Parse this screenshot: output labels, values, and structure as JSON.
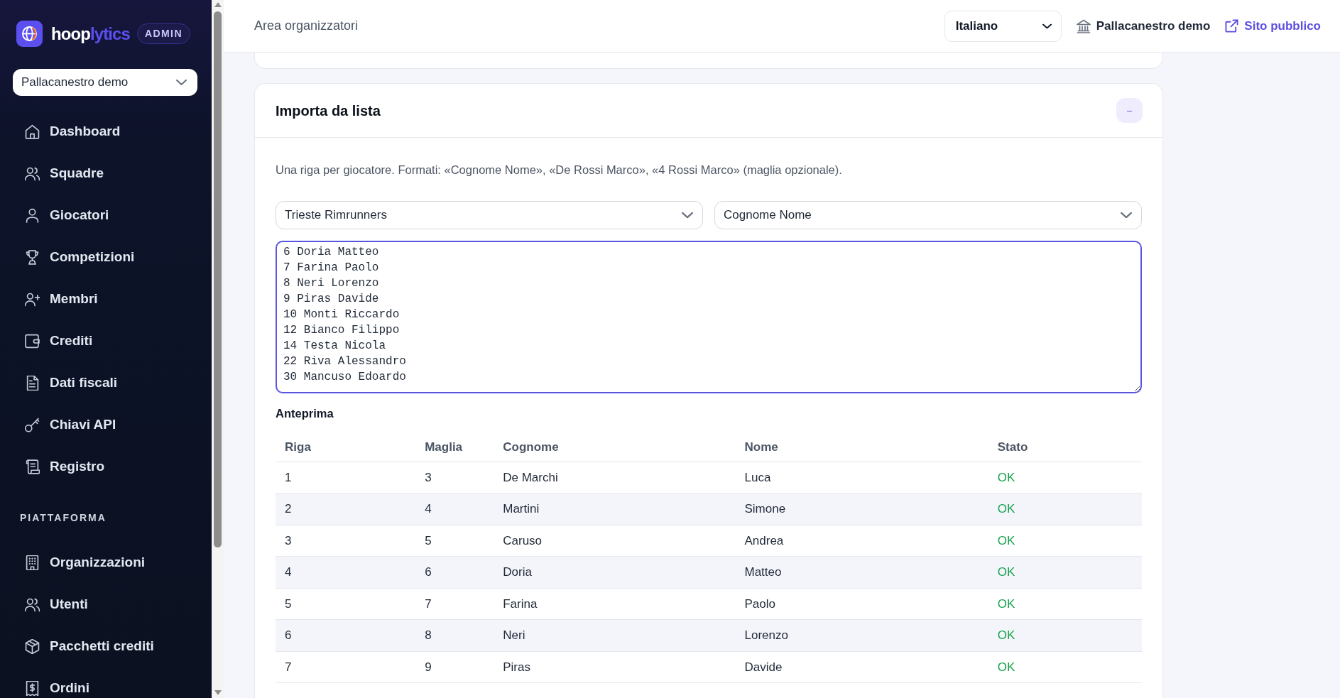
{
  "sidebar": {
    "logo": {
      "parts": [
        {
          "text": "hoop",
          "accent": false
        },
        {
          "text": "lytics",
          "accent": true
        }
      ]
    },
    "badge": "ADMIN",
    "organization_select": {
      "value": "Pallacanestro demo"
    },
    "sections": [
      {
        "items": [
          {
            "label": "Dashboard",
            "selected": false
          },
          {
            "label": "Squadre",
            "selected": false
          },
          {
            "label": "Giocatori",
            "selected": false
          },
          {
            "label": "Competizioni",
            "selected": false
          },
          {
            "label": "Membri",
            "selected": false
          },
          {
            "label": "Crediti",
            "selected": false
          },
          {
            "label": "Dati fiscali",
            "selected": false
          },
          {
            "label": "Chiavi API",
            "selected": false
          },
          {
            "label": "Registro",
            "selected": false
          }
        ]
      },
      {
        "heading": "PIATTAFORMA",
        "items": [
          {
            "label": "Organizzazioni",
            "selected": false
          },
          {
            "label": "Utenti",
            "selected": false
          },
          {
            "label": "Pacchetti crediti",
            "selected": false
          },
          {
            "label": "Ordini",
            "selected": false
          }
        ]
      }
    ]
  },
  "header": {
    "title": "Area organizzatori",
    "language_select": {
      "value": "Italiano"
    },
    "organization": "Pallacanestro demo",
    "public_site_link": "Sito pubblico"
  },
  "import_card": {
    "title": "Importa da lista",
    "collapse_button": "–",
    "description": "Una riga per giocatore. Formati: «Cognome Nome», «De Rossi Marco», «4 Rossi Marco» (maglia opzionale).",
    "team_select": {
      "value": "Trieste Rimrunners"
    },
    "format_select": {
      "value": "Cognome Nome"
    },
    "text_input": {
      "value": "6 Doria Matteo\n7 Farina Paolo\n8 Neri Lorenzo\n9 Piras Davide\n10 Monti Riccardo\n12 Bianco Filippo\n14 Testa Nicola\n22 Riva Alessandro\n30 Mancuso Edoardo",
      "focused": true
    },
    "preview": {
      "title": "Anteprima",
      "columns": [
        "Riga",
        "Maglia",
        "Cognome",
        "Nome",
        "Stato"
      ],
      "rows": [
        {
          "cells": [
            "1",
            "3",
            "De Marchi",
            "Luca"
          ],
          "status": {
            "text": "OK",
            "kind": "ok"
          }
        },
        {
          "cells": [
            "2",
            "4",
            "Martini",
            "Simone"
          ],
          "status": {
            "text": "OK",
            "kind": "ok"
          }
        },
        {
          "cells": [
            "3",
            "5",
            "Caruso",
            "Andrea"
          ],
          "status": {
            "text": "OK",
            "kind": "ok"
          }
        },
        {
          "cells": [
            "4",
            "6",
            "Doria",
            "Matteo"
          ],
          "status": {
            "text": "OK",
            "kind": "ok"
          }
        },
        {
          "cells": [
            "5",
            "7",
            "Farina",
            "Paolo"
          ],
          "status": {
            "text": "OK",
            "kind": "ok"
          }
        },
        {
          "cells": [
            "6",
            "8",
            "Neri",
            "Lorenzo"
          ],
          "status": {
            "text": "OK",
            "kind": "ok"
          }
        },
        {
          "cells": [
            "7",
            "9",
            "Piras",
            "Davide"
          ],
          "status": {
            "text": "OK",
            "kind": "ok"
          }
        }
      ]
    }
  }
}
